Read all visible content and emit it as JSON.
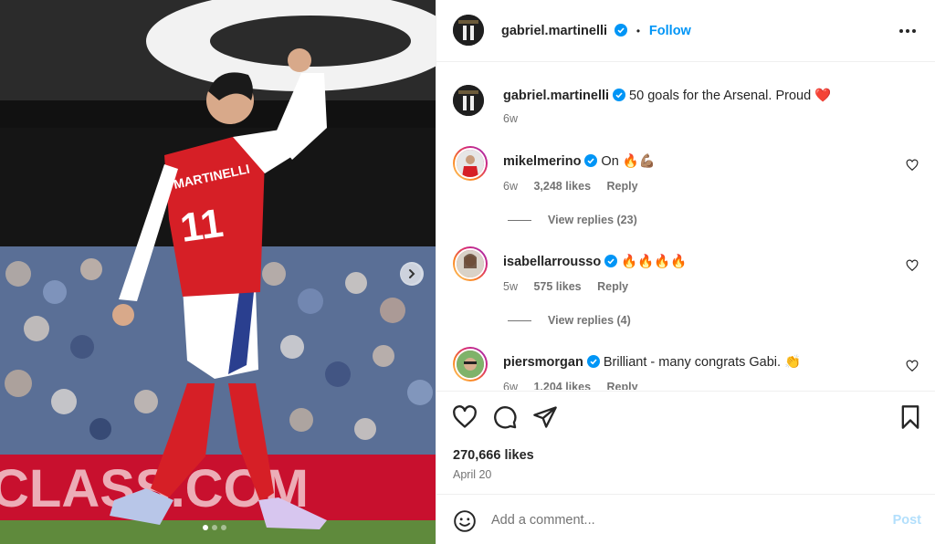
{
  "colors": {
    "accent": "#0095f6",
    "jersey_red": "#d61f26",
    "verified": "#0095f6",
    "heart": "#ff3040"
  },
  "media": {
    "next_icon": "chevron-right-icon",
    "dots": [
      true,
      false,
      false
    ],
    "banner_text": "CLASS.COM"
  },
  "header": {
    "username": "gabriel.martinelli",
    "separator": "•",
    "follow_label": "Follow",
    "more_icon": "more-horizontal-icon"
  },
  "caption": {
    "username": "gabriel.martinelli",
    "text": "50 goals for the Arsenal. Proud ❤️",
    "age": "6w"
  },
  "comments": [
    {
      "username": "mikelmerino",
      "text": "On 🔥💪🏽",
      "age": "6w",
      "likes": "3,248 likes",
      "reply": "Reply",
      "view_replies": "View replies (23)"
    },
    {
      "username": "isabellarrousso",
      "text": "🔥🔥🔥🔥",
      "age": "5w",
      "likes": "575 likes",
      "reply": "Reply",
      "view_replies": "View replies (4)"
    },
    {
      "username": "piersmorgan",
      "text": "Brilliant - many congrats Gabi. 👏",
      "age": "6w",
      "likes": "1,204 likes",
      "reply": "Reply"
    }
  ],
  "actions": {
    "likes": "270,666 likes",
    "date": "April 20"
  },
  "composer": {
    "placeholder": "Add a comment...",
    "post_label": "Post"
  }
}
